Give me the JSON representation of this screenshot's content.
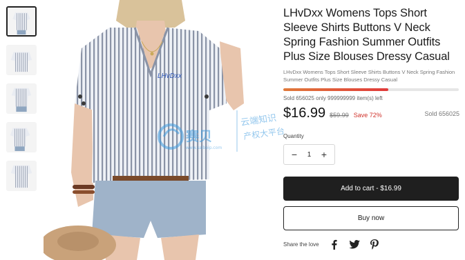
{
  "product": {
    "title": "LHvDxx Womens Tops Short Sleeve Shirts Buttons V Neck Spring Fashion Summer Outfits Plus Size Blouses Dressy Casual",
    "subtitle": "LHvDxx Womens Tops Short Sleeve Shirts Buttons V Neck Spring Fashion Summer Outfits Plus Size Blouses Dressy Casual",
    "brand_print": "LHvDxx"
  },
  "stock": {
    "text": "Sold 656025 only 999999999 item(s) left",
    "sold_fraction": 0.6
  },
  "pricing": {
    "price": "$16.99",
    "old_price": "$59.99",
    "save": "Save 72%",
    "sold": "Sold 656025"
  },
  "quantity": {
    "label": "Quantity",
    "minus": "−",
    "value": "1",
    "plus": "+"
  },
  "actions": {
    "add_to_cart": "Add to cart - $16.99",
    "buy_now": "Buy now"
  },
  "share": {
    "label": "Share the love",
    "icons": [
      "facebook-icon",
      "twitter-icon",
      "pinterest-icon"
    ]
  },
  "watermark": {
    "text_a": "云端知识",
    "text_b": "产权大平台",
    "logo": "赛贝",
    "url": "www.saibeip.com"
  },
  "colors": {
    "accent": "#d0322b",
    "button_dark": "#1f1f1f",
    "stripe": "#8a93a6"
  }
}
